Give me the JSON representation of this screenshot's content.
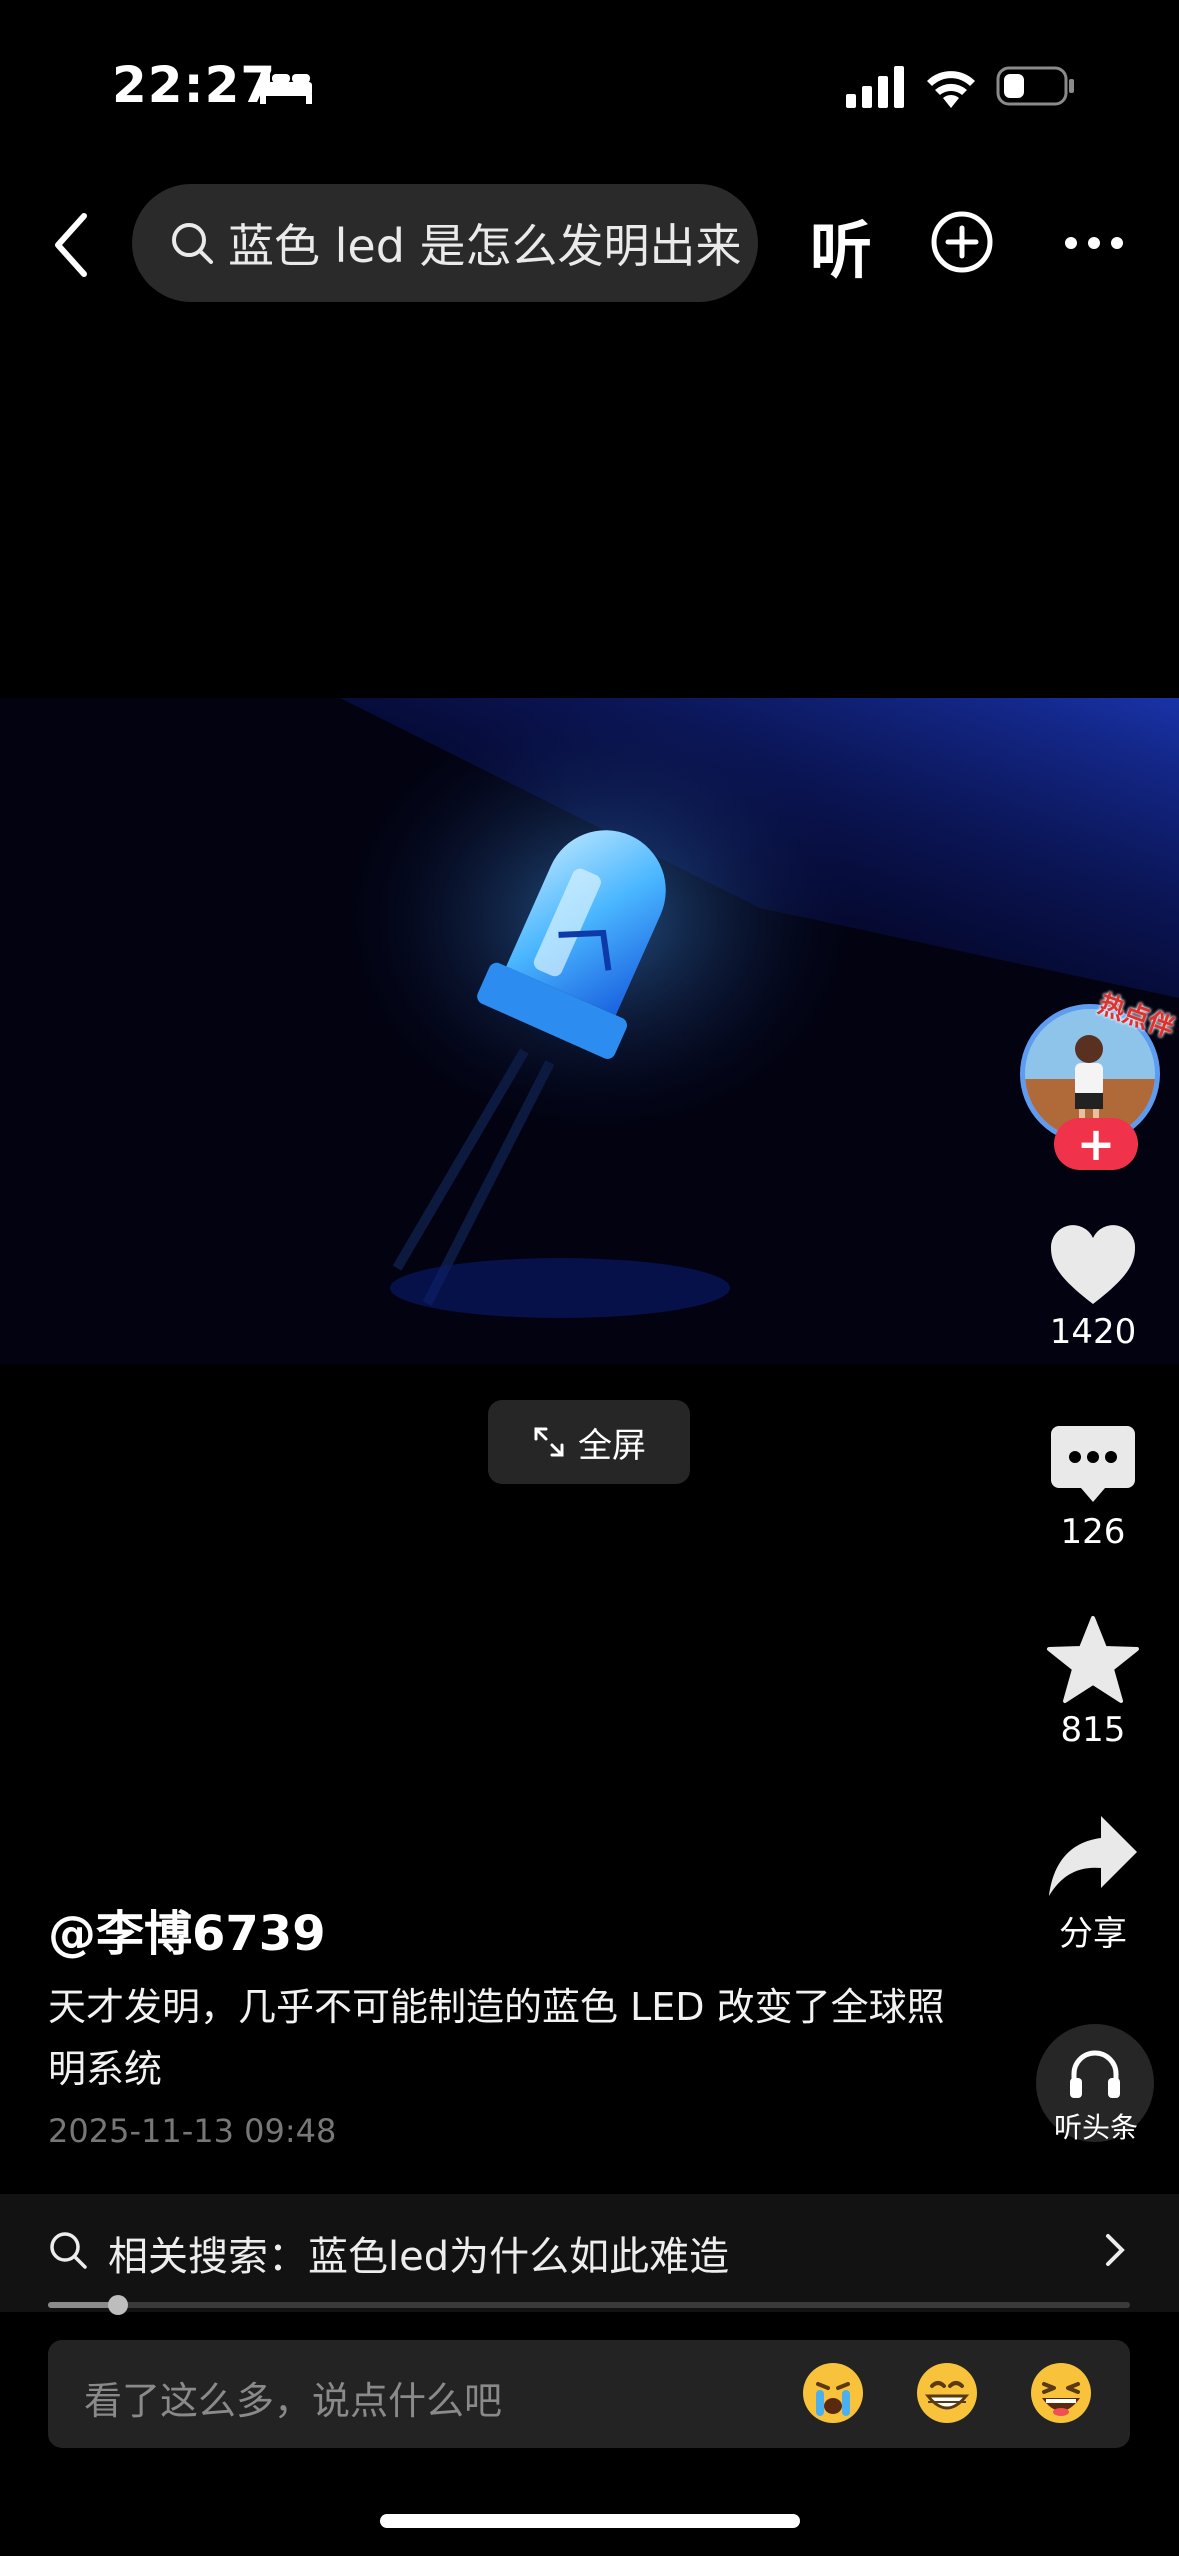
{
  "status_bar": {
    "time": "22:27",
    "sleep_icon": "bed-icon",
    "battery_icon": "battery-low-icon"
  },
  "top_bar": {
    "back_icon": "chevron-left-icon",
    "search_query": "蓝色 led 是怎么发明出来",
    "listen_label": "听",
    "add_icon": "plus-circle-icon",
    "more_icon": "more-dots-icon"
  },
  "video": {
    "fullscreen_label": "全屏"
  },
  "right_rail": {
    "hot_badge": "热点伴",
    "follow_symbol": "+",
    "likes": "1420",
    "comments": "126",
    "favorites": "815",
    "share_label": "分享",
    "listen_headline_label": "听头条"
  },
  "post": {
    "author": "@李博6739",
    "caption": "天才发明，几乎不可能制造的蓝色 LED 改变了全球照明系统",
    "timestamp": "2025-11-13 09:48"
  },
  "related_search": {
    "text": "相关搜索：蓝色led为什么如此难造"
  },
  "playback": {
    "progress": 0.065
  },
  "comment_bar": {
    "placeholder": "看了这么多，说点什么吧",
    "emojis": [
      "crying-face-icon",
      "grinning-face-icon",
      "laughing-face-icon"
    ]
  },
  "colors": {
    "accent_follow": "#f0334a",
    "avatar_ring": "#5e9cf2",
    "background": "#000000"
  }
}
